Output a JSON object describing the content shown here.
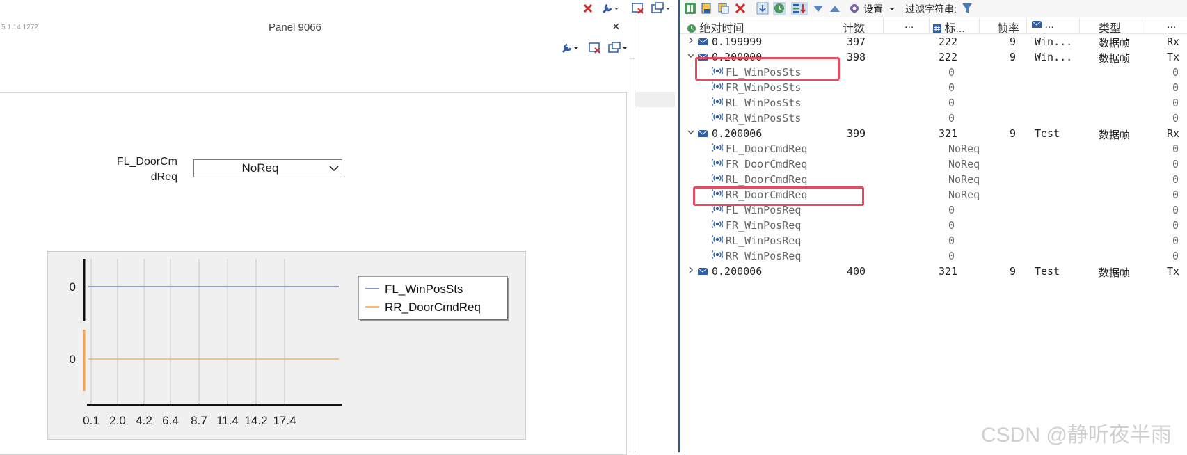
{
  "panel": {
    "version": "5.1.14.1272",
    "title": "Panel 9066",
    "close_glyph": "×",
    "door_label_line1": "FL_DoorCm",
    "door_label_line2": "dReq",
    "door_select_value": "NoReq"
  },
  "chart_data": {
    "type": "line",
    "x_ticks": [
      "0.1",
      "2.0",
      "4.2",
      "6.4",
      "8.7",
      "11.4",
      "14.2",
      "17.4"
    ],
    "series": [
      {
        "name": "FL_WinPosSts",
        "y_label": "0",
        "values": [
          0,
          0,
          0,
          0,
          0,
          0,
          0,
          0
        ],
        "color": "#5b6fb8"
      },
      {
        "name": "RR_DoorCmdReq",
        "y_label": "0",
        "values": [
          0,
          0,
          0,
          0,
          0,
          0,
          0,
          0
        ],
        "color": "#f5a348"
      }
    ],
    "grid": true,
    "legend": "right"
  },
  "trace": {
    "toolbar": {
      "settings_label": "设置",
      "filter_label": "过滤字符串:"
    },
    "columns": {
      "time": "绝对时间",
      "count": "计数",
      "dots1": "...",
      "id": "标...",
      "rate": "帧率",
      "name": "...",
      "type": "类型",
      "dir": "..."
    },
    "rows": [
      {
        "kind": "msg",
        "expanded": false,
        "time": "0.199999",
        "count": "397",
        "id": "222",
        "rate": "9",
        "name": "Win...",
        "type": "数据帧",
        "dir": "Rx"
      },
      {
        "kind": "msg",
        "expanded": true,
        "time": "0.200000",
        "count": "398",
        "id": "222",
        "rate": "9",
        "name": "Win...",
        "type": "数据帧",
        "dir": "Tx"
      },
      {
        "kind": "sig",
        "name": "FL_WinPosSts",
        "value": "0",
        "last": "0"
      },
      {
        "kind": "sig",
        "name": "FR_WinPosSts",
        "value": "0",
        "last": "0"
      },
      {
        "kind": "sig",
        "name": "RL_WinPosSts",
        "value": "0",
        "last": "0"
      },
      {
        "kind": "sig",
        "name": "RR_WinPosSts",
        "value": "0",
        "last": "0"
      },
      {
        "kind": "msg",
        "expanded": true,
        "time": "0.200006",
        "count": "399",
        "id": "321",
        "rate": "9",
        "name": "Test",
        "type": "数据帧",
        "dir": "Rx"
      },
      {
        "kind": "sig",
        "name": "FL_DoorCmdReq",
        "value": "NoReq",
        "last": "0"
      },
      {
        "kind": "sig",
        "name": "FR_DoorCmdReq",
        "value": "NoReq",
        "last": "0"
      },
      {
        "kind": "sig",
        "name": "RL_DoorCmdReq",
        "value": "NoReq",
        "last": "0"
      },
      {
        "kind": "sig",
        "name": "RR_DoorCmdReq",
        "value": "NoReq",
        "last": "0"
      },
      {
        "kind": "sig",
        "name": "FL_WinPosReq",
        "value": "0",
        "last": "0"
      },
      {
        "kind": "sig",
        "name": "FR_WinPosReq",
        "value": "0",
        "last": "0"
      },
      {
        "kind": "sig",
        "name": "RL_WinPosReq",
        "value": "0",
        "last": "0"
      },
      {
        "kind": "sig",
        "name": "RR_WinPosReq",
        "value": "0",
        "last": "0"
      },
      {
        "kind": "msg",
        "expanded": false,
        "time": "0.200006",
        "count": "400",
        "id": "321",
        "rate": "9",
        "name": "Test",
        "type": "数据帧",
        "dir": "Tx"
      }
    ]
  },
  "watermark": "CSDN @静听夜半雨",
  "colors": {
    "highlight": "#e84a5f",
    "accent": "#2c5a96"
  }
}
